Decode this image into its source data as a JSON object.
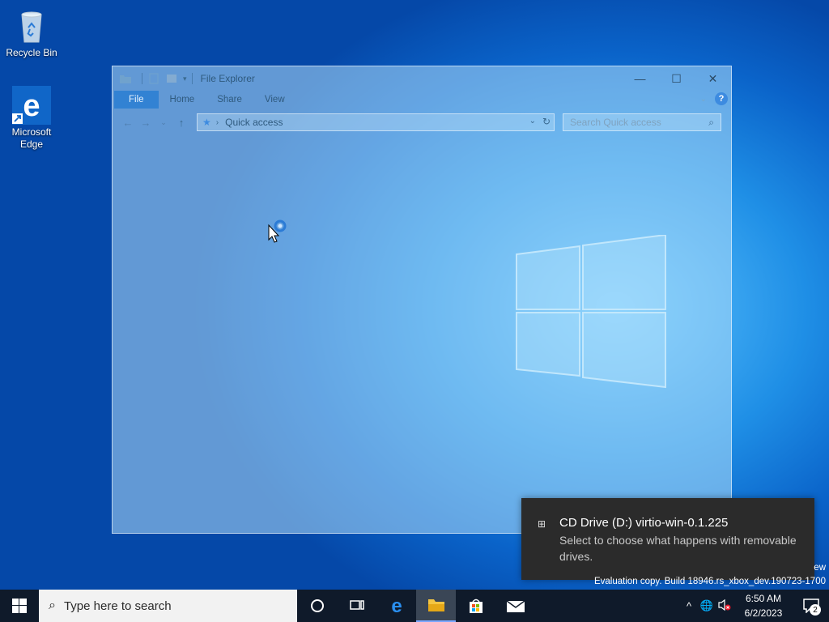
{
  "desktop": {
    "icons": [
      {
        "label": "Recycle Bin"
      },
      {
        "label": "Microsoft Edge"
      }
    ]
  },
  "explorer": {
    "title": "File Explorer",
    "tabs": {
      "file": "File",
      "home": "Home",
      "share": "Share",
      "view": "View"
    },
    "help": "?",
    "address": "Quick access",
    "search_placeholder": "Search Quick access"
  },
  "toast": {
    "title": "CD Drive (D:) virtio-win-0.1.225",
    "body": "Select to choose what happens with removable drives."
  },
  "watermark": {
    "partial": "ew",
    "build": "Evaluation copy. Build 18946.rs_xbox_dev.190723-1700"
  },
  "taskbar": {
    "search_placeholder": "Type here to search",
    "time": "6:50 AM",
    "date": "6/2/2023",
    "notification_count": "2"
  },
  "icons": {
    "start": "windows-icon",
    "cortana": "circle-icon",
    "task_view": "task-view-icon",
    "edge": "edge-icon",
    "file_explorer": "folder-icon",
    "store": "store-icon",
    "mail": "mail-icon"
  },
  "colors": {
    "taskbar": "#0f1a2a",
    "toast": "#2b2b2b",
    "accent": "#1e78d2"
  }
}
